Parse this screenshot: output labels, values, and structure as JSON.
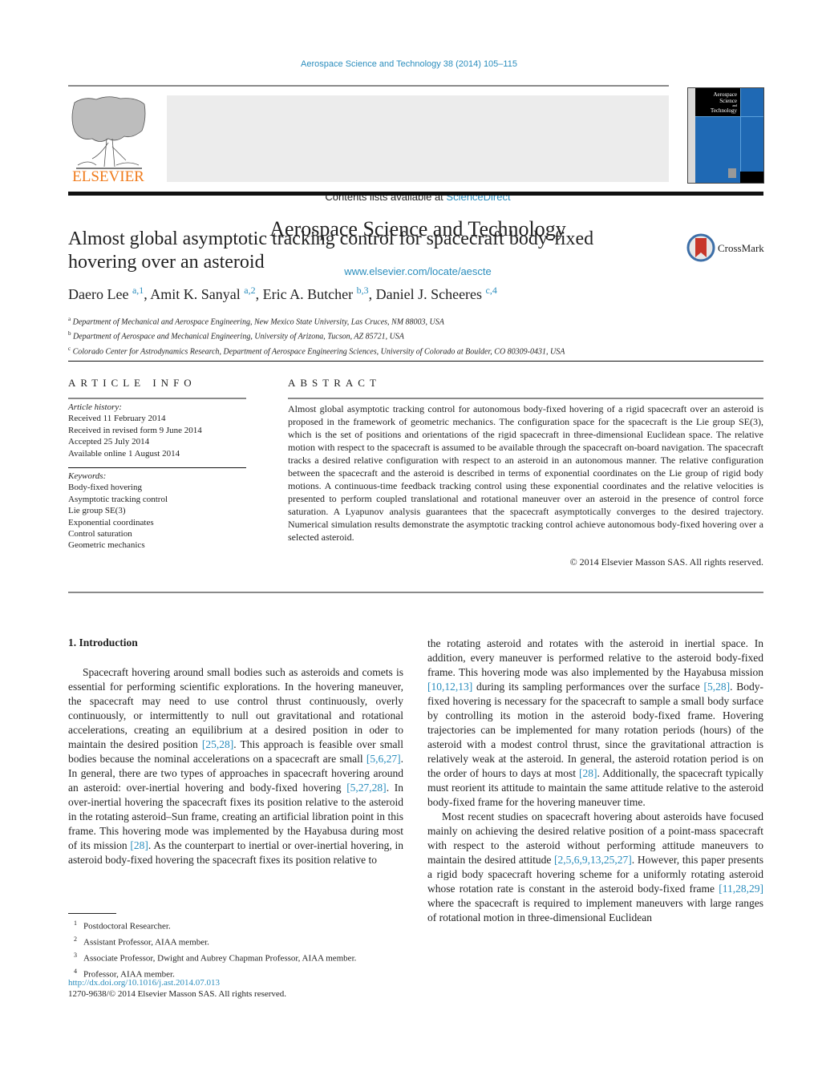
{
  "journal_citation": "Aerospace Science and Technology 38 (2014) 105–115",
  "header": {
    "publisher_logo_text": "ELSEVIER",
    "contents_prefix": "Contents lists available at ",
    "contents_link": "ScienceDirect",
    "journal_name": "Aerospace Science and Technology",
    "journal_url": "www.elsevier.com/locate/aescte",
    "cover_title_lines": [
      "Aerospace",
      "Science",
      "and",
      "Technology"
    ]
  },
  "article": {
    "title": "Almost global asymptotic tracking control for spacecraft body-fixed hovering over an asteroid",
    "crossmark_label": "CrossMark",
    "authors": [
      {
        "name": "Daero Lee",
        "marks": "a,1"
      },
      {
        "name": "Amit K. Sanyal",
        "marks": "a,2"
      },
      {
        "name": "Eric A. Butcher",
        "marks": "b,3"
      },
      {
        "name": "Daniel J. Scheeres",
        "marks": "c,4"
      }
    ],
    "affiliations": [
      {
        "mark": "a",
        "text": "Department of Mechanical and Aerospace Engineering, New Mexico State University, Las Cruces, NM 88003, USA"
      },
      {
        "mark": "b",
        "text": "Department of Aerospace and Mechanical Engineering, University of Arizona, Tucson, AZ 85721, USA"
      },
      {
        "mark": "c",
        "text": "Colorado Center for Astrodynamics Research, Department of Aerospace Engineering Sciences, University of Colorado at Boulder, CO 80309-0431, USA"
      }
    ]
  },
  "article_info": {
    "heading": "ARTICLE INFO",
    "history_label": "Article history:",
    "history": [
      "Received 11 February 2014",
      "Received in revised form 9 June 2014",
      "Accepted 25 July 2014",
      "Available online 1 August 2014"
    ],
    "keywords_label": "Keywords:",
    "keywords": [
      "Body-fixed hovering",
      "Asymptotic tracking control",
      "Lie group SE(3)",
      "Exponential coordinates",
      "Control saturation",
      "Geometric mechanics"
    ]
  },
  "abstract": {
    "heading": "ABSTRACT",
    "text": "Almost global asymptotic tracking control for autonomous body-fixed hovering of a rigid spacecraft over an asteroid is proposed in the framework of geometric mechanics. The configuration space for the spacecraft is the Lie group SE(3), which is the set of positions and orientations of the rigid spacecraft in three-dimensional Euclidean space. The relative motion with respect to the spacecraft is assumed to be available through the spacecraft on-board navigation. The spacecraft tracks a desired relative configuration with respect to an asteroid in an autonomous manner. The relative configuration between the spacecraft and the asteroid is described in terms of exponential coordinates on the Lie group of rigid body motions. A continuous-time feedback tracking control using these exponential coordinates and the relative velocities is presented to perform coupled translational and rotational maneuver over an asteroid in the presence of control force saturation. A Lyapunov analysis guarantees that the spacecraft asymptotically converges to the desired trajectory. Numerical simulation results demonstrate the asymptotic tracking control achieve autonomous body-fixed hovering over a selected asteroid.",
    "copyright": "© 2014 Elsevier Masson SAS. All rights reserved."
  },
  "body": {
    "section_heading": "1. Introduction",
    "left_column": [
      {
        "t": "Spacecraft hovering around small bodies such as asteroids and comets is essential for performing scientific explorations. In the hovering maneuver, the spacecraft may need to use control thrust continuously, overly continuously, or intermittently to null out gravitational and rotational accelerations, creating an equilibrium at a desired position in oder to maintain the desired position "
      },
      {
        "ref": "[25,28]"
      },
      {
        "t": ". This approach is feasible over small bodies because the nominal accelerations on a spacecraft are small "
      },
      {
        "ref": "[5,6,27]"
      },
      {
        "t": ". In general, there are two types of approaches in spacecraft hovering around an asteroid: over-inertial hovering and body-fixed hovering "
      },
      {
        "ref": "[5,27,28]"
      },
      {
        "t": ". In over-inertial hovering the spacecraft fixes its position relative to the asteroid in the rotating asteroid–Sun frame, creating an artificial libration point in this frame. This hovering mode was implemented by the Hayabusa during most of its mission "
      },
      {
        "ref": "[28]"
      },
      {
        "t": ". As the counterpart to inertial or over-inertial hovering, in asteroid body-fixed hovering the spacecraft fixes its position relative to"
      }
    ],
    "right_column_p1": [
      {
        "t": "the rotating asteroid and rotates with the asteroid in inertial space. In addition, every maneuver is performed relative to the asteroid body-fixed frame. This hovering mode was also implemented by the Hayabusa mission "
      },
      {
        "ref": "[10,12,13]"
      },
      {
        "t": " during its sampling performances over the surface "
      },
      {
        "ref": "[5,28]"
      },
      {
        "t": ". Body-fixed hovering is necessary for the spacecraft to sample a small body surface by controlling its motion in the asteroid body-fixed frame. Hovering trajectories can be implemented for many rotation periods (hours) of the asteroid with a modest control thrust, since the gravitational attraction is relatively weak at the asteroid. In general, the asteroid rotation period is on the order of hours to days at most "
      },
      {
        "ref": "[28]"
      },
      {
        "t": ". Additionally, the spacecraft typically must reorient its attitude to maintain the same attitude relative to the asteroid body-fixed frame for the hovering maneuver time."
      }
    ],
    "right_column_p2": [
      {
        "t": "Most recent studies on spacecraft hovering about asteroids have focused mainly on achieving the desired relative position of a point-mass spacecraft with respect to the asteroid without performing attitude maneuvers to maintain the desired attitude "
      },
      {
        "ref": "[2,5,6,9,13,25,27]"
      },
      {
        "t": ". However, this paper presents a rigid body spacecraft hovering scheme for a uniformly rotating asteroid whose rotation rate is constant in the asteroid body-fixed frame "
      },
      {
        "ref": "[11,28,29]"
      },
      {
        "t": " where the spacecraft is required to implement maneuvers with large ranges of rotational motion in three-dimensional Euclidean"
      }
    ]
  },
  "footnotes": [
    {
      "mark": "1",
      "text": "Postdoctoral Researcher."
    },
    {
      "mark": "2",
      "text": "Assistant Professor, AIAA member."
    },
    {
      "mark": "3",
      "text": "Associate Professor, Dwight and Aubrey Chapman Professor, AIAA member."
    },
    {
      "mark": "4",
      "text": "Professor, AIAA member."
    }
  ],
  "doi": "http://dx.doi.org/10.1016/j.ast.2014.07.013",
  "issn_copyright": "1270-9638/© 2014 Elsevier Masson SAS. All rights reserved.",
  "colors": {
    "link": "#2a8dbd",
    "elsevier_orange": "#f07a1a",
    "cover_blue": "#1f69b4"
  }
}
